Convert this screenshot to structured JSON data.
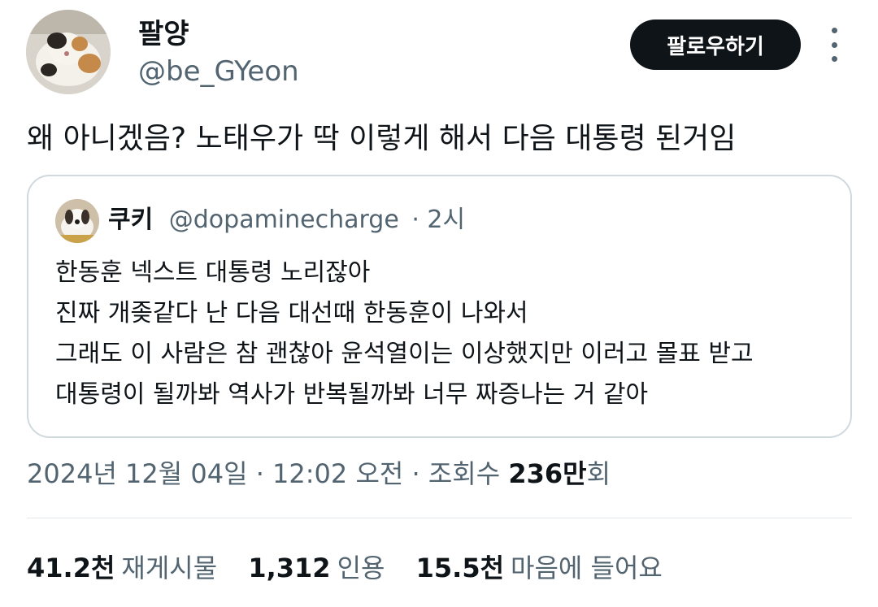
{
  "author": {
    "display_name": "팔양",
    "handle": "@be_GYeon",
    "avatar_icon": "cat-avatar-icon"
  },
  "actions": {
    "follow_label": "팔로우하기",
    "more_icon": "more-vertical-icon"
  },
  "tweet": {
    "text": "왜 아니겠음? 노태우가 딱 이렇게 해서 다음 대통령 된거임"
  },
  "quoted": {
    "display_name": "쿠키",
    "handle": "@dopaminecharge",
    "time": "· 2시",
    "avatar_icon": "dog-avatar-icon",
    "lines": [
      "한동훈 넥스트 대통령 노리잖아",
      "진짜 개좆같다 난 다음 대선때 한동훈이 나와서",
      "그래도 이 사람은 참 괜찮아 윤석열이는 이상했지만 이러고 몰표 받고",
      "대통령이 될까봐 역사가 반복될까봐 너무 짜증나는 거 같아"
    ]
  },
  "meta": {
    "timestamp": "2024년 12월 04일 · 12:02 오전 · 조회수",
    "views_number": "236만",
    "views_suffix": "회"
  },
  "stats": [
    {
      "value": "41.2천",
      "label": "재게시물"
    },
    {
      "value": "1,312",
      "label": "인용"
    },
    {
      "value": "15.5천",
      "label": "마음에 들어요"
    }
  ],
  "colors": {
    "text_primary": "#0f1419",
    "text_secondary": "#536471",
    "border": "#cfd9de",
    "button_bg": "#0f1419"
  }
}
